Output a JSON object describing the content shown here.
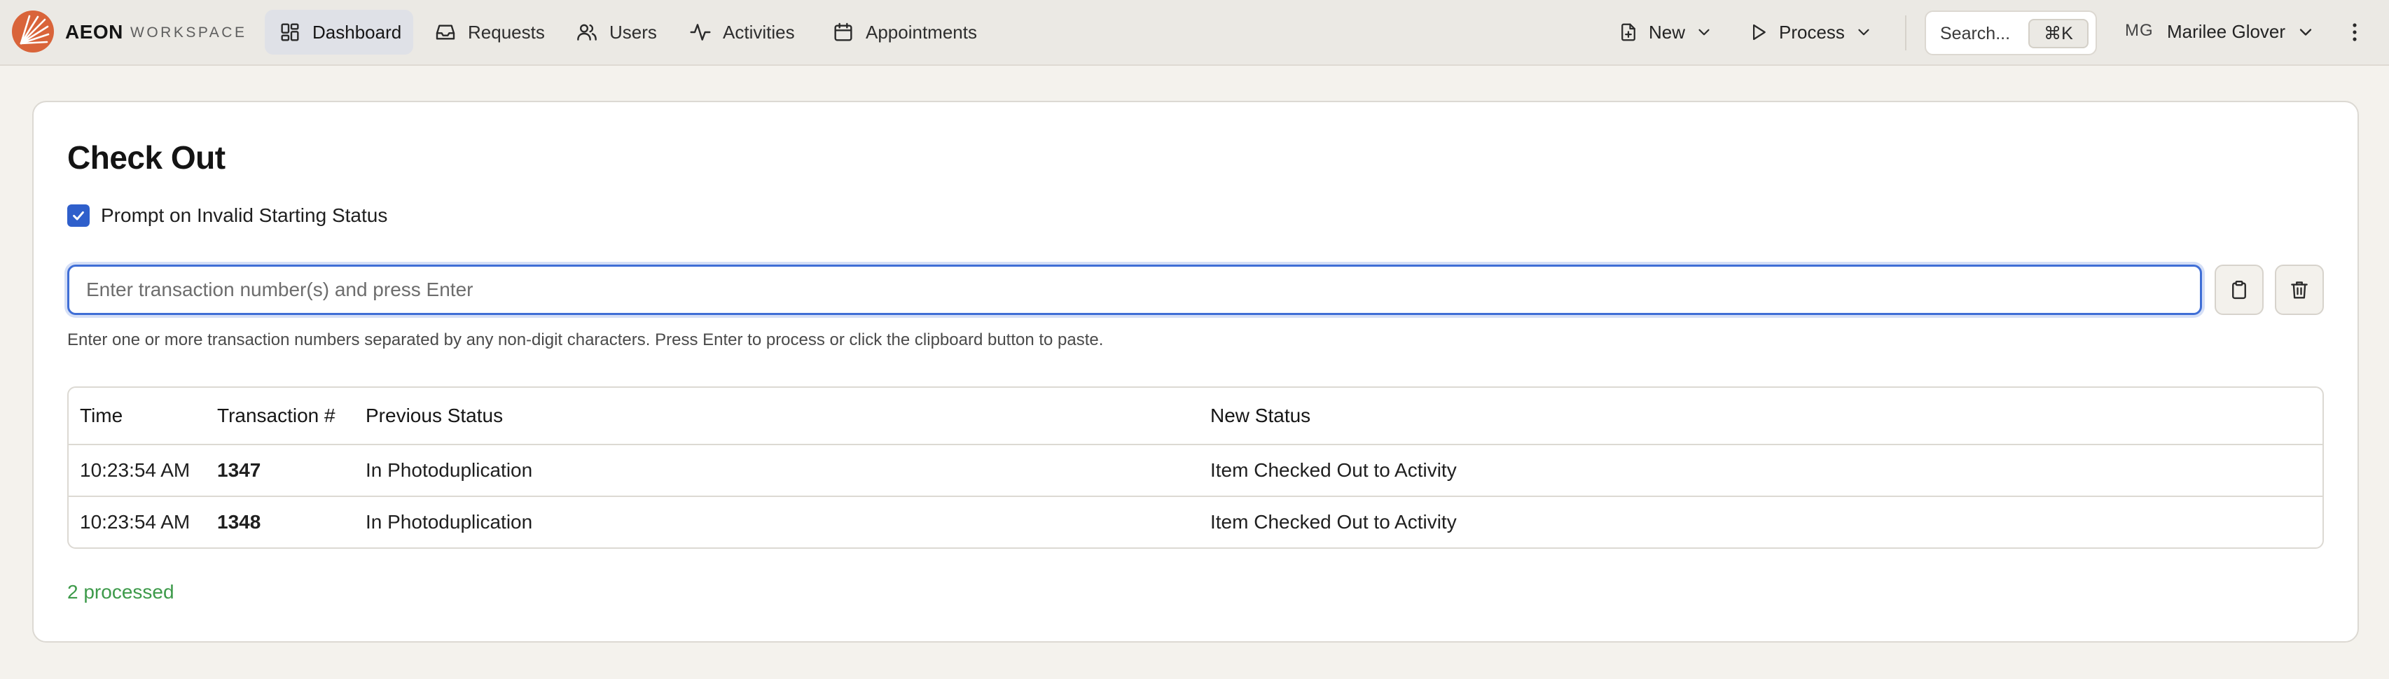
{
  "brand": {
    "name": "AEON",
    "subtitle": "WORKSPACE"
  },
  "nav": [
    {
      "label": "Dashboard",
      "icon": "dashboard-icon",
      "active": true
    },
    {
      "label": "Requests",
      "icon": "inbox-icon"
    },
    {
      "label": "Users",
      "icon": "users-icon"
    },
    {
      "label": "Activities",
      "icon": "activity-icon"
    },
    {
      "label": "Appointments",
      "icon": "calendar-icon"
    }
  ],
  "actions": {
    "new_label": "New",
    "process_label": "Process"
  },
  "search": {
    "placeholder": "Search...",
    "shortcut": "⌘K"
  },
  "user": {
    "initials": "MG",
    "name": "Marilee Glover"
  },
  "page": {
    "title": "Check Out",
    "prompt_label": "Prompt on Invalid Starting Status",
    "prompt_checked": true,
    "input_placeholder": "Enter transaction number(s) and press Enter",
    "help_text": "Enter one or more transaction numbers separated by any non-digit characters. Press Enter to process or click the clipboard button to paste."
  },
  "table": {
    "headers": [
      "Time",
      "Transaction #",
      "Previous Status",
      "New Status"
    ],
    "rows": [
      {
        "time": "10:23:54 AM",
        "transaction": "1347",
        "previous": "In Photoduplication",
        "new": "Item Checked Out to Activity"
      },
      {
        "time": "10:23:54 AM",
        "transaction": "1348",
        "previous": "In Photoduplication",
        "new": "Item Checked Out to Activity"
      }
    ]
  },
  "summary": "2 processed",
  "colors": {
    "accent": "#3f6ed6",
    "checkbox": "#2f5fcb",
    "success": "#3d9a4a",
    "brand_orange": "#d9643a",
    "topbar_bg": "#ebe9e4",
    "page_bg": "#f4f2ed"
  }
}
